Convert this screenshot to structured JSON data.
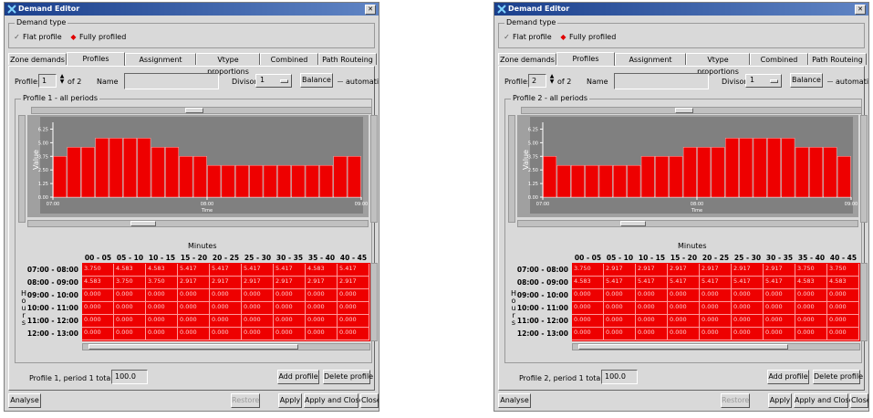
{
  "windows": [
    {
      "id": "L",
      "title": "Demand Editor",
      "demand_type_label": "Demand type",
      "flat_profile_label": "Flat profile",
      "fully_profiled_label": "Fully profiled",
      "tabs": [
        "Zone demands",
        "Profiles",
        "Assignment",
        "Vtype proportions",
        "Combined",
        "Path Routeing"
      ],
      "profile_label": "Profile:",
      "profile_value": "1",
      "of_label": "of 2",
      "name_label": "Name",
      "name_value": "",
      "divisor_label": "Divisor",
      "divisor_value": "1",
      "balance_label": "Balance",
      "automatic_label": "automatic",
      "group_label": "Profile 1 - all periods",
      "chart_data": {
        "type": "bar",
        "ylabel": "Value",
        "xlabel": "Time",
        "yticks": [
          "0.00",
          "1.25",
          "2.50",
          "3.75",
          "5.00",
          "6.25"
        ],
        "ylim": [
          0,
          6.875
        ],
        "xticks": [
          "07:00",
          "08:00",
          "09:00"
        ],
        "values": [
          3.75,
          4.583,
          4.583,
          5.417,
          5.417,
          5.417,
          5.417,
          4.583,
          4.583,
          3.75,
          3.75,
          2.917,
          2.917,
          2.917,
          2.917,
          2.917,
          2.917,
          2.917,
          2.917,
          2.917,
          3.75,
          3.75
        ],
        "bar_color": "#ee0000",
        "plot_bg": "#808080"
      },
      "minutes_label": "Minutes",
      "hours_label": "Hours",
      "columns": [
        "00 - 05",
        "05 - 10",
        "10 - 15",
        "15 - 20",
        "20 - 25",
        "25 - 30",
        "30 - 35",
        "35 - 40",
        "40 - 45",
        "4"
      ],
      "rows": [
        "07:00 - 08:00",
        "08:00 - 09:00",
        "09:00 - 10:00",
        "10:00 - 11:00",
        "11:00 - 12:00",
        "12:00 - 13:00"
      ],
      "table": [
        [
          "3.750",
          "4.583",
          "4.583",
          "5.417",
          "5.417",
          "5.417",
          "5.417",
          "4.583",
          "5.417",
          ""
        ],
        [
          "4.583",
          "3.750",
          "3.750",
          "2.917",
          "2.917",
          "2.917",
          "2.917",
          "2.917",
          "2.917",
          ""
        ],
        [
          "0.000",
          "0.000",
          "0.000",
          "0.000",
          "0.000",
          "0.000",
          "0.000",
          "0.000",
          "0.000",
          ""
        ],
        [
          "0.000",
          "0.000",
          "0.000",
          "0.000",
          "0.000",
          "0.000",
          "0.000",
          "0.000",
          "0.000",
          ""
        ],
        [
          "0.000",
          "0.000",
          "0.000",
          "0.000",
          "0.000",
          "0.000",
          "0.000",
          "0.000",
          "0.000",
          ""
        ],
        [
          "0.000",
          "0.000",
          "0.000",
          "0.000",
          "0.000",
          "0.000",
          "0.000",
          "0.000",
          "0.000",
          ""
        ]
      ],
      "period_total_label": "Profile 1, period 1 total",
      "period_total_value": "100.0",
      "add_profile_label": "Add profile",
      "delete_profile_label": "Delete profile",
      "analyse_label": "Analyse",
      "restore_label": "Restore",
      "apply_label": "Apply",
      "apply_close_label": "Apply and Close",
      "close_label": "Close"
    },
    {
      "id": "R",
      "title": "Demand Editor",
      "demand_type_label": "Demand type",
      "flat_profile_label": "Flat profile",
      "fully_profiled_label": "Fully profiled",
      "tabs": [
        "Zone demands",
        "Profiles",
        "Assignment",
        "Vtype proportions",
        "Combined",
        "Path Routeing"
      ],
      "profile_label": "Profile:",
      "profile_value": "2",
      "of_label": "of 2",
      "name_label": "Name",
      "name_value": "",
      "divisor_label": "Divisor",
      "divisor_value": "1",
      "balance_label": "Balance",
      "automatic_label": "automatic",
      "group_label": "Profile 2 - all periods",
      "chart_data": {
        "type": "bar",
        "ylabel": "Value",
        "xlabel": "Time",
        "yticks": [
          "0.00",
          "1.25",
          "2.50",
          "3.75",
          "5.00",
          "6.25"
        ],
        "ylim": [
          0,
          6.875
        ],
        "xticks": [
          "07:00",
          "08:00",
          "09:00"
        ],
        "values": [
          3.75,
          2.917,
          2.917,
          2.917,
          2.917,
          2.917,
          2.917,
          3.75,
          3.75,
          3.75,
          4.583,
          4.583,
          4.583,
          5.417,
          5.417,
          5.417,
          5.417,
          5.417,
          4.583,
          4.583,
          4.583,
          3.75
        ],
        "bar_color": "#ee0000",
        "plot_bg": "#808080"
      },
      "minutes_label": "Minutes",
      "hours_label": "Hours",
      "columns": [
        "00 - 05",
        "05 - 10",
        "10 - 15",
        "15 - 20",
        "20 - 25",
        "25 - 30",
        "30 - 35",
        "35 - 40",
        "40 - 45"
      ],
      "rows": [
        "07:00 - 08:00",
        "08:00 - 09:00",
        "09:00 - 10:00",
        "10:00 - 11:00",
        "11:00 - 12:00",
        "12:00 - 13:00"
      ],
      "table": [
        [
          "3.750",
          "2.917",
          "2.917",
          "2.917",
          "2.917",
          "2.917",
          "2.917",
          "3.750",
          "3.750"
        ],
        [
          "4.583",
          "5.417",
          "5.417",
          "5.417",
          "5.417",
          "5.417",
          "5.417",
          "4.583",
          "4.583"
        ],
        [
          "0.000",
          "0.000",
          "0.000",
          "0.000",
          "0.000",
          "0.000",
          "0.000",
          "0.000",
          "0.000"
        ],
        [
          "0.000",
          "0.000",
          "0.000",
          "0.000",
          "0.000",
          "0.000",
          "0.000",
          "0.000",
          "0.000"
        ],
        [
          "0.000",
          "0.000",
          "0.000",
          "0.000",
          "0.000",
          "0.000",
          "0.000",
          "0.000",
          "0.000"
        ],
        [
          "0.000",
          "0.000",
          "0.000",
          "0.000",
          "0.000",
          "0.000",
          "0.000",
          "0.000",
          "0.000"
        ]
      ],
      "period_total_label": "Profile 2, period 1 total",
      "period_total_value": "100.0",
      "add_profile_label": "Add profile",
      "delete_profile_label": "Delete profile",
      "analyse_label": "Analyse",
      "restore_label": "Restore",
      "apply_label": "Apply",
      "apply_close_label": "Apply and Close",
      "close_label": "Close"
    }
  ]
}
